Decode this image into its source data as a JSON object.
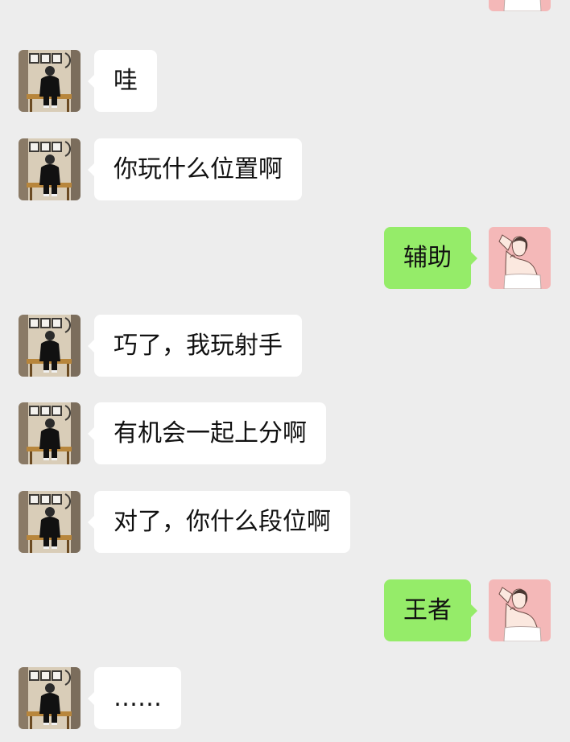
{
  "chat": {
    "messages": [
      {
        "sender": "other",
        "text": "哇"
      },
      {
        "sender": "other",
        "text": "你玩什么位置啊"
      },
      {
        "sender": "self",
        "text": "辅助"
      },
      {
        "sender": "other",
        "text": "巧了，我玩射手"
      },
      {
        "sender": "other",
        "text": "有机会一起上分啊"
      },
      {
        "sender": "other",
        "text": "对了，你什么段位啊"
      },
      {
        "sender": "self",
        "text": "王者"
      },
      {
        "sender": "other",
        "text": "……"
      }
    ]
  },
  "colors": {
    "background": "#ededed",
    "incoming_bubble": "#ffffff",
    "outgoing_bubble": "#95ec69",
    "text": "#111111",
    "self_avatar_bg": "#f4b8b8"
  }
}
